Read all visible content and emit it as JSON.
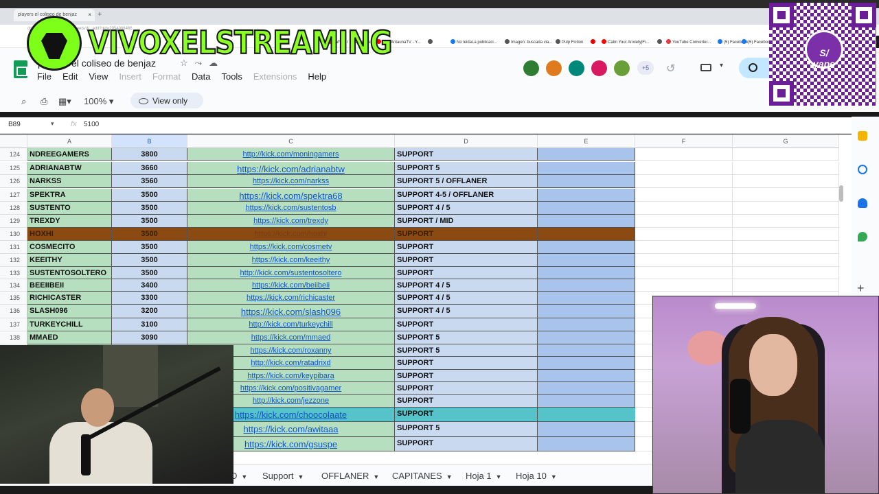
{
  "browser": {
    "tab_title": "players el coliseo de benjaz",
    "url": "docs.google.com/spreadsheets/d/...edit?gid=2054006466",
    "bookmarks": [
      {
        "label": "Wheel / Streamlabs",
        "color": "#e23c3c"
      },
      {
        "label": "(22) AntaunaTV - Y...",
        "color": "#ff0000"
      },
      {
        "label": "",
        "color": "#555555"
      },
      {
        "label": "No leidaLa publicaci...",
        "color": "#1877f2"
      },
      {
        "label": "Imagen: buscada via...",
        "color": "#555555"
      },
      {
        "label": "Pulp Fiction",
        "color": "#555555"
      },
      {
        "label": "",
        "color": "#e00000"
      },
      {
        "label": "Calm Your Anxiety|Fi...",
        "color": "#ff0000"
      },
      {
        "label": "",
        "color": "#555555"
      },
      {
        "label": "YouTube Converter...",
        "color": "#e23c3c"
      },
      {
        "label": "(5) Facebook",
        "color": "#1877f2"
      },
      {
        "label": "(5) Facebook",
        "color": "#1877f2"
      }
    ]
  },
  "doc": {
    "title": "players el coliseo de benjaz",
    "menu": [
      {
        "label": "File",
        "disabled": false
      },
      {
        "label": "Edit",
        "disabled": false
      },
      {
        "label": "View",
        "disabled": false
      },
      {
        "label": "Insert",
        "disabled": true
      },
      {
        "label": "Format",
        "disabled": true
      },
      {
        "label": "Data",
        "disabled": false
      },
      {
        "label": "Tools",
        "disabled": false
      },
      {
        "label": "Extensions",
        "disabled": true
      },
      {
        "label": "Help",
        "disabled": false
      }
    ],
    "collaborators_more": "+5",
    "zoom": "100%",
    "view_only_label": "View only"
  },
  "formula_bar": {
    "cell_ref": "B89",
    "fx": "fx",
    "value": "5100"
  },
  "columns": [
    "A",
    "B",
    "C",
    "D",
    "E",
    "F",
    "G"
  ],
  "rows": [
    {
      "n": "124",
      "name": "NDREEGAMERS",
      "score": "3800",
      "link": "http://kick.com/moningamers",
      "role": "SUPPORT",
      "style": ""
    },
    {
      "n": "125",
      "name": "ADRIANABTW",
      "score": "3660",
      "link": "https://kick.com/adrianabtw",
      "role": "SUPPORT 5",
      "style": "big"
    },
    {
      "n": "126",
      "name": "NARKSS",
      "score": "3560",
      "link": "https://kick.com/narkss",
      "role": "SUPPORT 5 / OFFLANER",
      "style": ""
    },
    {
      "n": "127",
      "name": "SPEKTRA",
      "score": "3500",
      "link": "https://kick.com/spektra68",
      "role": "SUPPORT 4-5 / OFFLANER",
      "style": "big"
    },
    {
      "n": "128",
      "name": "SUSTENTO",
      "score": "3500",
      "link": "https://kick.com/sustentosb",
      "role": "SUPPORT 4 / 5",
      "style": ""
    },
    {
      "n": "129",
      "name": "TREXDY",
      "score": "3500",
      "link": "https://kick.com/trexdy",
      "role": "SUPPORT / MID",
      "style": ""
    },
    {
      "n": "130",
      "name": "HOXHI",
      "score": "3500",
      "link": "https://kick.com/hoxhi",
      "role": "SUPPORT",
      "style": "brown"
    },
    {
      "n": "131",
      "name": "COSMECITO",
      "score": "3500",
      "link": "https://kick.com/cosmetv",
      "role": "SUPPORT",
      "style": ""
    },
    {
      "n": "132",
      "name": "KEEITHY",
      "score": "3500",
      "link": "https://kick.com/keeithy",
      "role": "SUPPORT",
      "style": ""
    },
    {
      "n": "133",
      "name": "SUSTENTOSOLTERO",
      "score": "3500",
      "link": "http://kick.com/sustentosoltero",
      "role": "SUPPORT",
      "style": ""
    },
    {
      "n": "134",
      "name": "BEEIIBEII",
      "score": "3400",
      "link": "https://kick.com/beiibeii",
      "role": "SUPPORT 4 / 5",
      "style": ""
    },
    {
      "n": "135",
      "name": "RICHICASTER",
      "score": "3300",
      "link": "https://kick.com/richicaster",
      "role": "SUPPORT 4 / 5",
      "style": ""
    },
    {
      "n": "136",
      "name": "SLASH096",
      "score": "3200",
      "link": "https://kick.com/slash096",
      "role": "SUPPORT 4 / 5",
      "style": "big"
    },
    {
      "n": "137",
      "name": "TURKEYCHILL",
      "score": "3100",
      "link": "http://kick.com/turkeychill",
      "role": "SUPPORT",
      "style": ""
    },
    {
      "n": "138",
      "name": "MMAED",
      "score": "3090",
      "link": "https://kick.com/mmaed",
      "role": "SUPPORT 5",
      "style": ""
    },
    {
      "n": "",
      "name": "",
      "score": "",
      "link": "https://kick.com/roxanny",
      "role": "SUPPORT 5",
      "style": ""
    },
    {
      "n": "",
      "name": "",
      "score": "",
      "link": "http://kick.com/ratadrixd",
      "role": "SUPPORT",
      "style": ""
    },
    {
      "n": "",
      "name": "",
      "score": "",
      "link": "https://kick.com/keypibara",
      "role": "SUPPORT",
      "style": ""
    },
    {
      "n": "",
      "name": "",
      "score": "",
      "link": "https://kick.com/positivagamer",
      "role": "SUPPORT",
      "style": ""
    },
    {
      "n": "",
      "name": "",
      "score": "",
      "link": "http://kick.com/jezzone",
      "role": "SUPPORT",
      "style": ""
    },
    {
      "n": "",
      "name": "",
      "score": "",
      "link": "https://kick.com/choocolaate",
      "role": "SUPPORT",
      "style": "teal big"
    },
    {
      "n": "",
      "name": "",
      "score": "",
      "link": "https://kick.com/awitaaa",
      "role": "SUPPORT 5",
      "style": "big"
    },
    {
      "n": "",
      "name": "",
      "score": "",
      "link": "https://kick.com/gsuspe",
      "role": "SUPPORT",
      "style": "big"
    }
  ],
  "sheet_tabs": [
    "D",
    "Support",
    "OFFLANER",
    "CAPITANES",
    "Hoja 1",
    "Hoja 10"
  ],
  "overlay": {
    "brand": "VIVOXELSTREAMING",
    "qr_badge": "yape",
    "qr_currency": "S/"
  }
}
